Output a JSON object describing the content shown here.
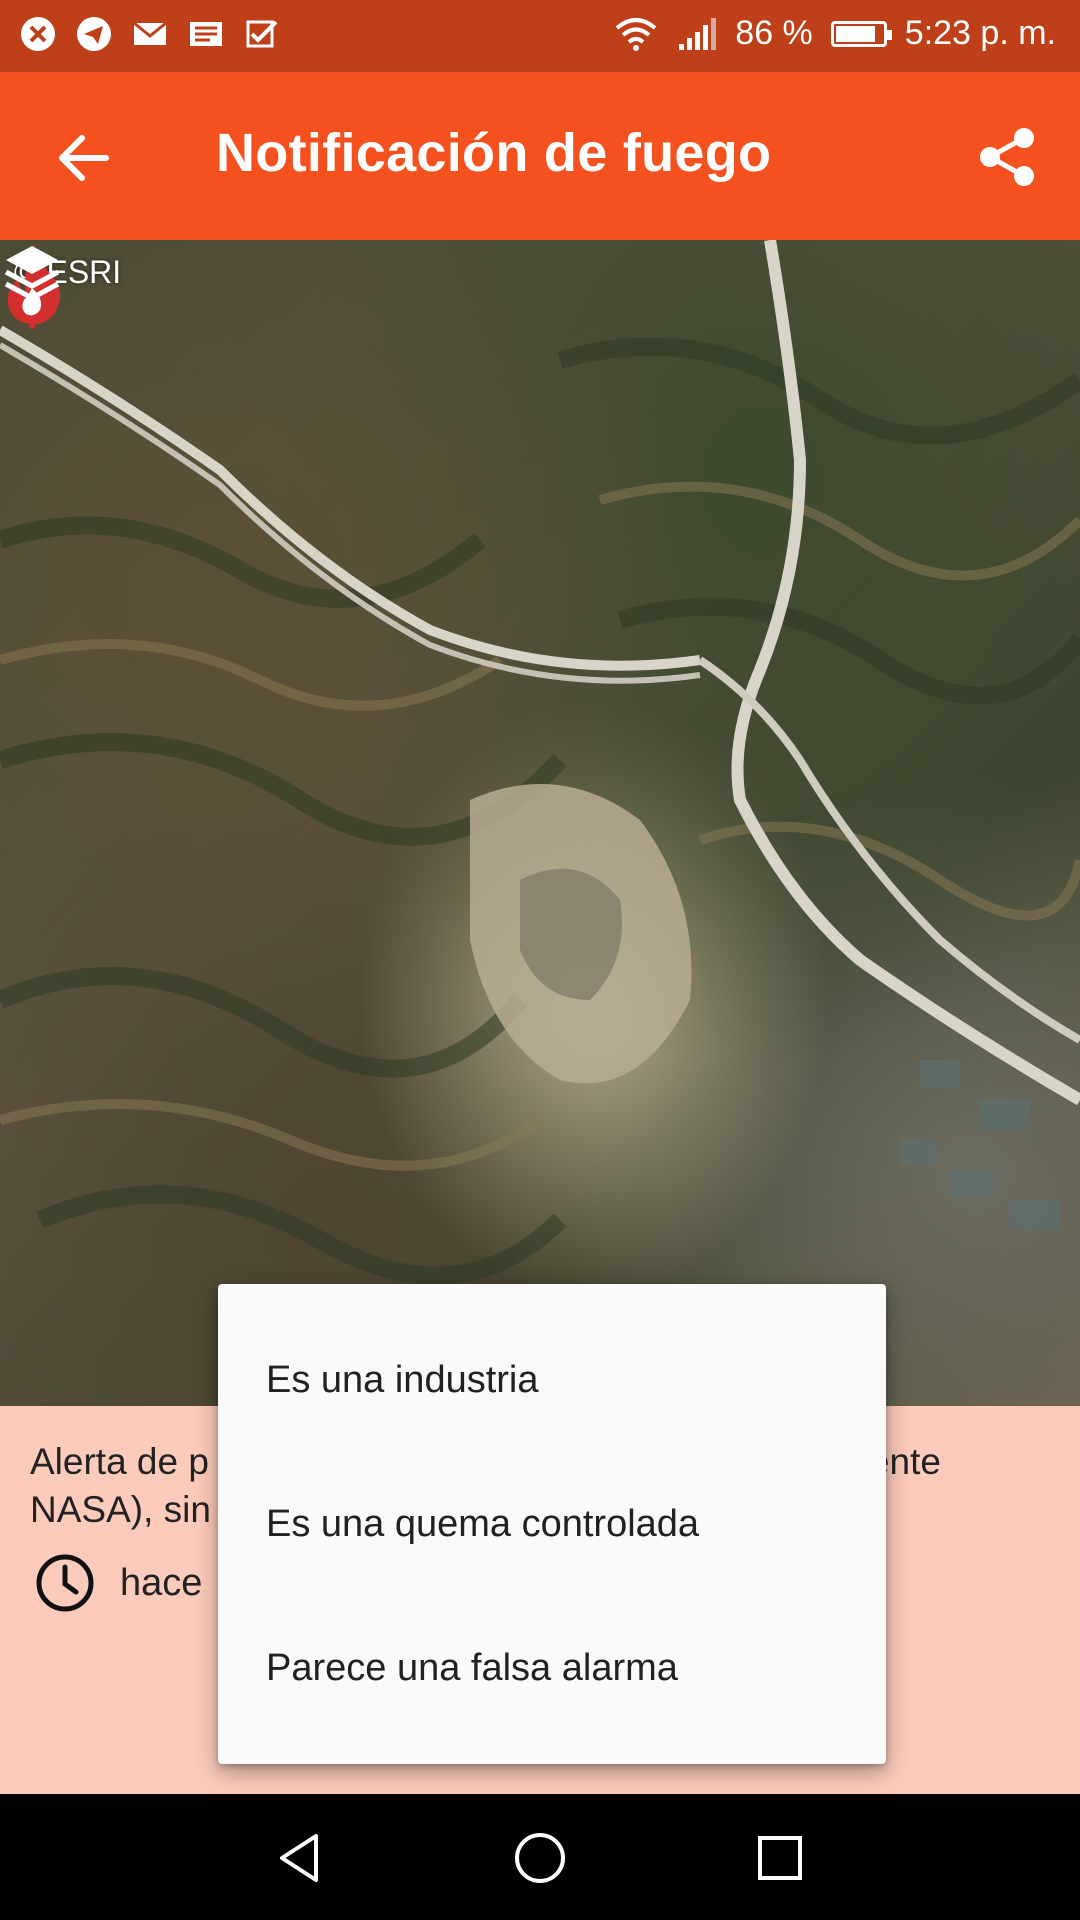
{
  "status_bar": {
    "notification_icons": [
      "close-circle-icon",
      "telegram-icon",
      "mail-icon",
      "news-icon",
      "check-list-icon"
    ],
    "battery_percent": "86 %",
    "battery_level": 0.86,
    "time": "5:23 p. m."
  },
  "appbar": {
    "title": "Notificación de fuego",
    "back_icon": "arrow-back-icon",
    "share_icon": "share-icon"
  },
  "map": {
    "attribution": "© ESRI",
    "marker_icon": "fire-icon",
    "layers_icon": "layers-icon"
  },
  "info": {
    "alert_text": "Alerta de p                                                            (fuente NASA), sin",
    "time_text": "hace "
  },
  "menu": {
    "items": [
      "Es una industria",
      "Es una quema controlada",
      "Parece una falsa alarma"
    ]
  },
  "nav": {
    "back": "nav-back-icon",
    "home": "nav-home-icon",
    "recents": "nav-recents-icon"
  },
  "colors": {
    "status_bar": "#bf3f18",
    "appbar": "#f4511e",
    "info_panel": "#fdcbbb",
    "menu": "#fafafa",
    "fire": "#d32f2f"
  }
}
